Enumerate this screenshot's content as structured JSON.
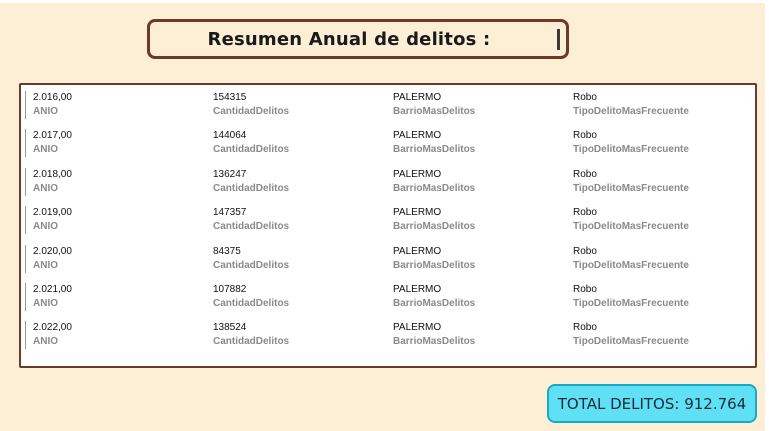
{
  "title": "Resumen Anual de delitos :",
  "table": {
    "field_labels": [
      "ANIO",
      "CantidadDelitos",
      "BarrioMasDelitos",
      "TipoDelitoMasFrecuente"
    ],
    "rows": [
      {
        "anio": "2.016,00",
        "cantidad": "154315",
        "barrio": "PALERMO",
        "tipo": "Robo"
      },
      {
        "anio": "2.017,00",
        "cantidad": "144064",
        "barrio": "PALERMO",
        "tipo": "Robo"
      },
      {
        "anio": "2.018,00",
        "cantidad": "136247",
        "barrio": "PALERMO",
        "tipo": "Robo"
      },
      {
        "anio": "2.019,00",
        "cantidad": "147357",
        "barrio": "PALERMO",
        "tipo": "Robo"
      },
      {
        "anio": "2.020,00",
        "cantidad": "84375",
        "barrio": "PALERMO",
        "tipo": "Robo"
      },
      {
        "anio": "2.021,00",
        "cantidad": "107882",
        "barrio": "PALERMO",
        "tipo": "Robo"
      },
      {
        "anio": "2.022,00",
        "cantidad": "138524",
        "barrio": "PALERMO",
        "tipo": "Robo"
      }
    ]
  },
  "total": "TOTAL DELITOS: 912.764",
  "colors": {
    "background": "#fdefd5",
    "border": "#6b3a2a",
    "total_bg": "#5fe0f5",
    "label_gray": "#8a8a8a"
  }
}
